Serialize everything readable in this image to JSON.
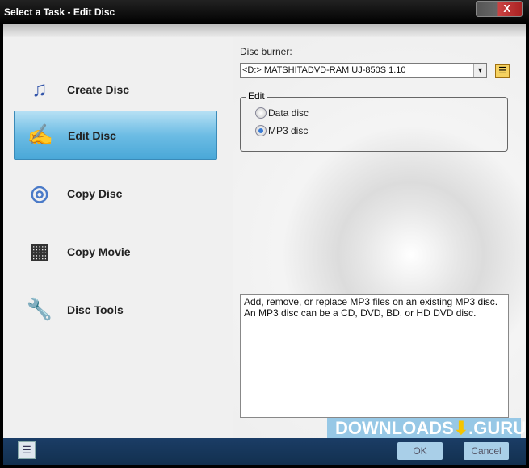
{
  "window": {
    "title": "Select a Task - Edit Disc",
    "close": "X"
  },
  "tasks": [
    {
      "label": "Create Disc",
      "icon": "create-disc-icon",
      "glyph": "♫"
    },
    {
      "label": "Edit Disc",
      "icon": "edit-disc-icon",
      "glyph": "✍"
    },
    {
      "label": "Copy Disc",
      "icon": "copy-disc-icon",
      "glyph": "◎"
    },
    {
      "label": "Copy Movie",
      "icon": "film-icon",
      "glyph": "▦"
    },
    {
      "label": "Disc Tools",
      "icon": "screwdriver-icon",
      "glyph": "🔧"
    }
  ],
  "selected_task": "Edit Disc",
  "burner": {
    "label": "Disc burner:",
    "value": "<D:>  MATSHITADVD-RAM UJ-850S  1.10",
    "dropdown": "▾"
  },
  "edit_group": {
    "title": "Edit",
    "options": [
      {
        "label": "Data disc",
        "checked": false
      },
      {
        "label": "MP3 disc",
        "checked": true
      }
    ]
  },
  "description": "Add, remove, or replace MP3 files on an existing MP3 disc. An MP3 disc can be a CD, DVD, BD, or HD DVD disc.",
  "footer": {
    "ok": "OK",
    "cancel": "Cancel"
  },
  "watermark": {
    "text1": "DOWNLOADS",
    "arrow": "⬇",
    "text2": ".GURU"
  }
}
